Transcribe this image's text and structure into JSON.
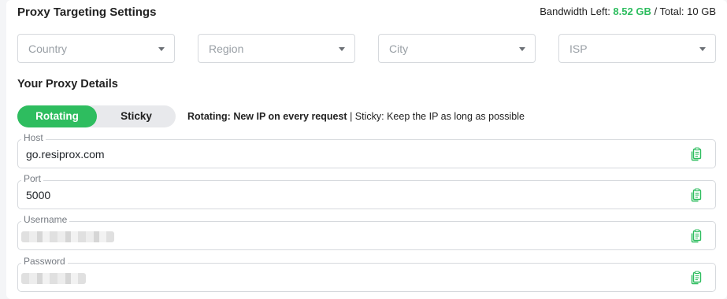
{
  "settings": {
    "title": "Proxy Targeting Settings",
    "bandwidth_prefix": "Bandwidth Left: ",
    "bandwidth_left": "8.52 GB",
    "bandwidth_sep": " / Total: ",
    "bandwidth_total": "10 GB",
    "accent_color": "#2ebd5f"
  },
  "filters": [
    {
      "placeholder": "Country"
    },
    {
      "placeholder": "Region"
    },
    {
      "placeholder": "City"
    },
    {
      "placeholder": "ISP"
    }
  ],
  "details": {
    "title": "Your Proxy Details",
    "mode_toggle": {
      "rotating": "Rotating",
      "sticky": "Sticky",
      "selected": "Rotating"
    },
    "mode_desc_bold": "Rotating: New IP on every request",
    "mode_desc_rest": " | Sticky: Keep the IP as long as possible"
  },
  "fields": {
    "host": {
      "label": "Host",
      "value": "go.resiprox.com"
    },
    "port": {
      "label": "Port",
      "value": "5000"
    },
    "username": {
      "label": "Username",
      "value": ""
    },
    "password": {
      "label": "Password",
      "value": ""
    }
  },
  "icons": {
    "copy": "copy-icon",
    "caret": "chevron-down-icon"
  }
}
